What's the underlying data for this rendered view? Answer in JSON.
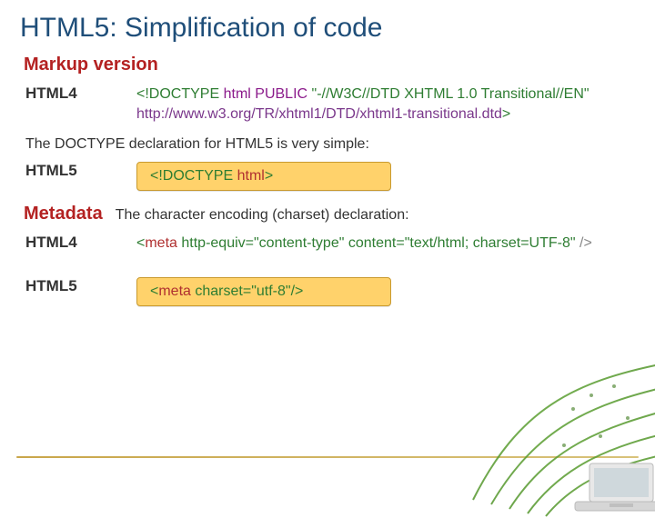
{
  "title": "HTML5: Simplification of code",
  "sections": {
    "markup": {
      "heading": "Markup version",
      "html4_label": "HTML4",
      "html4_doctype": {
        "open": "<!",
        "keyword": "DOCTYPE",
        "root": "html",
        "public_kw": "PUBLIC",
        "fpi": "\"-//W3C//DTD XHTML 1.0 Transitional//EN\"",
        "sysid": "http://www.w3.org/TR/xhtml1/DTD/xhtml1-transitional.dtd",
        "close": ">"
      },
      "caption": "The DOCTYPE declaration for HTML5 is very simple:",
      "html5_label": "HTML5",
      "html5_doctype": {
        "open": "<!",
        "keyword": "DOCTYPE",
        "root": "html",
        "close": ">"
      }
    },
    "metadata": {
      "heading": "Metadata",
      "caption": "The character encoding (charset) declaration:",
      "html4_label": "HTML4",
      "html4_meta": {
        "open": "<",
        "tag": "meta",
        "attr1": "http-equiv=",
        "val1": "\"content-type\"",
        "attr2": "content=",
        "val2": "\"text/html; charset=UTF-8\"",
        "close": " />"
      },
      "html5_label": "HTML5",
      "html5_meta": {
        "open": "<",
        "tag": "meta",
        "attr1": "charset=",
        "val1": "\"utf-8\"",
        "close": "/>"
      }
    }
  }
}
